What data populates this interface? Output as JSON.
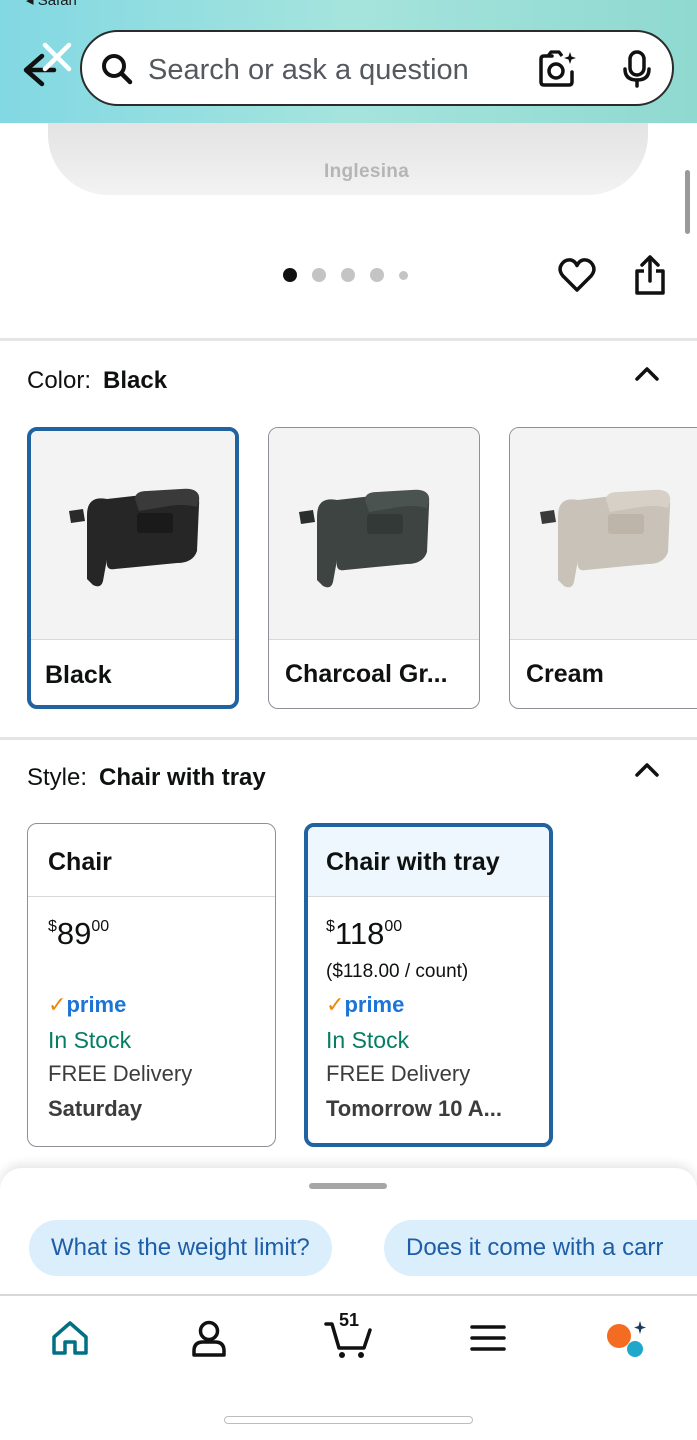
{
  "status_bar": {
    "back_app": "◂ Safari"
  },
  "search": {
    "placeholder": "Search or ask a question"
  },
  "product": {
    "brand": "Inglesina",
    "image_count": 5,
    "active_image": 1
  },
  "color": {
    "label": "Color:",
    "selected": "Black",
    "options": [
      {
        "name": "Black",
        "selected": true
      },
      {
        "name": "Charcoal Gr...",
        "selected": false
      },
      {
        "name": "Cream",
        "selected": false
      }
    ]
  },
  "style": {
    "label": "Style:",
    "selected": "Chair with tray",
    "options": [
      {
        "title": "Chair",
        "price_whole": "89",
        "price_fraction": "00",
        "currency": "$",
        "unit_price": "",
        "prime": "prime",
        "stock": "In Stock",
        "delivery": "FREE Delivery",
        "delivery_day": "Saturday",
        "selected": false
      },
      {
        "title": "Chair with tray",
        "price_whole": "118",
        "price_fraction": "00",
        "currency": "$",
        "unit_price": "($118.00 / count)",
        "prime": "prime",
        "stock": "In Stock",
        "delivery": "FREE Delivery",
        "delivery_day": "Tomorrow 10 A...",
        "selected": true
      }
    ]
  },
  "suggestions": [
    "What is the weight limit?",
    "Does it come with a carr"
  ],
  "nav": {
    "cart_count": "51"
  },
  "colors": {
    "header_gradient": "#82d8e3",
    "selected_border": "#2162a1",
    "prime_blue": "#1b74d6",
    "prime_check": "#f08804",
    "in_stock": "#067d62",
    "chip_bg": "#dbeefb",
    "chip_text": "#1d5ea6",
    "nav_accent": "#007185"
  },
  "icons": [
    "back-icon",
    "close-icon",
    "search-icon",
    "camera-lens-icon",
    "microphone-icon",
    "heart-icon",
    "share-icon",
    "chevron-up-icon",
    "home-icon",
    "account-icon",
    "cart-icon",
    "menu-icon",
    "rufus-icon"
  ]
}
